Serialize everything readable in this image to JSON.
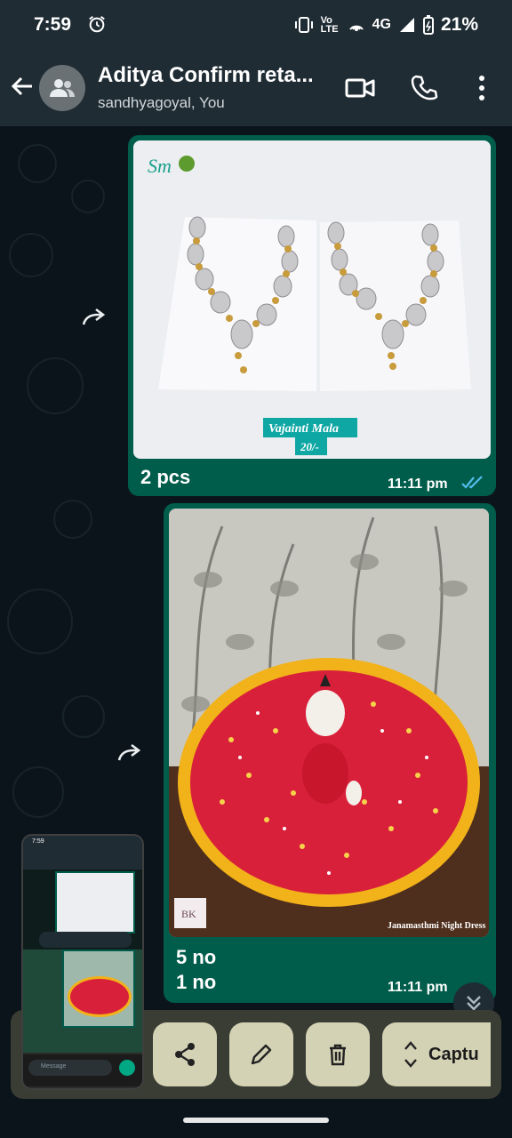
{
  "status_bar": {
    "time": "7:59",
    "network": "4G",
    "volte": "Vo LTE",
    "battery": "21%"
  },
  "header": {
    "title": "Aditya Confirm reta...",
    "subtitle": "sandhyagoyal, You"
  },
  "messages": [
    {
      "image_logo_text": "Sm",
      "image_label": "Vajainti Mala",
      "image_price": "20/-",
      "caption": "2 pcs",
      "time": "11:11 pm"
    },
    {
      "image_watermark": "Janamasthmi Night Dress",
      "image_logo_text": "BK",
      "caption_line1": "5 no",
      "caption_line2": "1 no",
      "time": "11:11 pm"
    }
  ],
  "screenshot_toolbar": {
    "capture_label": "Captu"
  },
  "thumbnail": {
    "time": "7:59",
    "message_placeholder": "Message"
  },
  "colors": {
    "header_bg": "#1f2c34",
    "chat_bg": "#0b141a",
    "outgoing_bubble": "#005c4b",
    "read_ticks": "#53bdeb",
    "toolbar_button": "#d4d2b5"
  }
}
